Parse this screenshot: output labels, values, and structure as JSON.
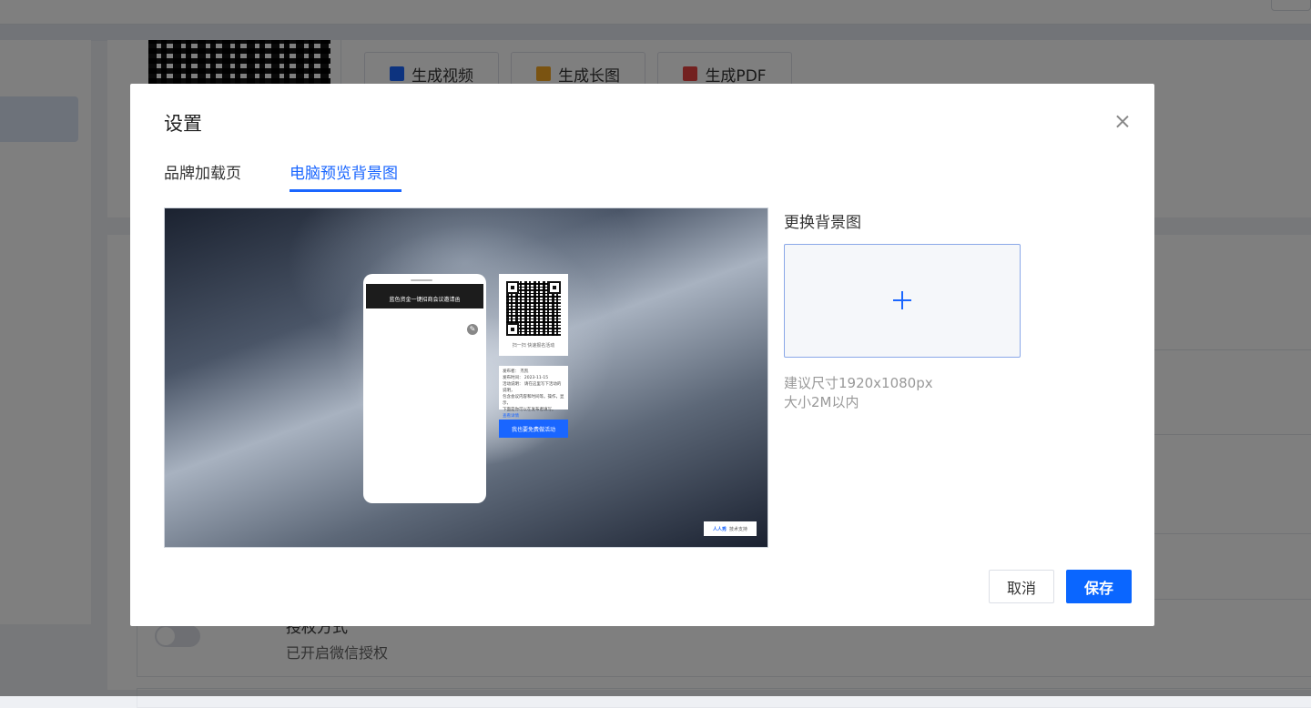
{
  "background": {
    "tools": [
      {
        "label": "生成视频",
        "icon": "video-icon",
        "color": "#1a66ff"
      },
      {
        "label": "生成长图",
        "icon": "image-icon",
        "color": "#f5a623"
      },
      {
        "label": "生成PDF",
        "icon": "pdf-icon",
        "color": "#e64340"
      }
    ],
    "auth_title": "授权方式",
    "auth_sub": "已开启微信授权"
  },
  "modal": {
    "title": "设置",
    "tabs": [
      {
        "label": "品牌加载页",
        "active": false
      },
      {
        "label": "电脑预览背景图",
        "active": true
      }
    ],
    "preview": {
      "phone_header": "蓝色资金一键招商会议邀请函",
      "qr_caption": "扫一扫 快速报名活动",
      "info_lines": [
        "发布者：  杰凯",
        "发布时间：  2023-11-15",
        "活动说明：  请在这里写下活动的说明，",
        "包含会议内容和时间等。操作，显示，",
        "下面是你可以在发布者填写。"
      ],
      "info_link": "查看详情",
      "join_button": "我也要免费做活动",
      "tech_logo": "人人秀",
      "tech_text": "技术支持"
    },
    "replace_label": "更换背景图",
    "hint_size": "建议尺寸1920x1080px",
    "hint_max": "大小2M以内",
    "cancel_label": "取消",
    "save_label": "保存"
  },
  "colors": {
    "accent": "#1a66ff",
    "save_bg": "#0a66ff"
  }
}
